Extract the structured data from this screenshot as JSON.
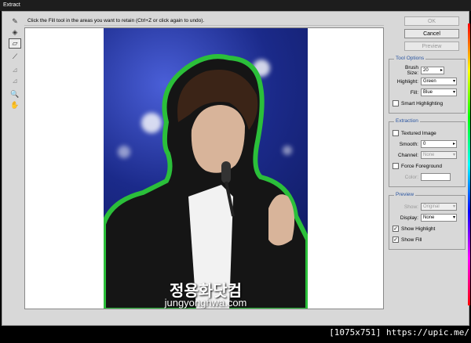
{
  "window": {
    "title": "Extract"
  },
  "instruction": "Click the Fill tool in the areas you want to retain (Ctrl+Z or click again to undo).",
  "tools": [
    {
      "name": "edge-highlighter-icon",
      "glyph": "✎"
    },
    {
      "name": "fill-bucket-icon",
      "glyph": "◈"
    },
    {
      "name": "eraser-icon",
      "glyph": "▱"
    },
    {
      "name": "eyedropper-icon",
      "glyph": "⟋"
    },
    {
      "name": "cleanup-tool-icon",
      "glyph": "⊿"
    },
    {
      "name": "edge-touchup-icon",
      "glyph": "⊿"
    },
    {
      "name": "zoom-icon",
      "glyph": "🔍"
    },
    {
      "name": "hand-icon",
      "glyph": "✋"
    }
  ],
  "buttons": {
    "ok": "OK",
    "cancel": "Cancel",
    "preview": "Preview"
  },
  "tool_options": {
    "title": "Tool Options",
    "brush_size_label": "Brush Size:",
    "brush_size_value": "20",
    "highlight_label": "Highlight:",
    "highlight_value": "Green",
    "fill_label": "Fill:",
    "fill_value": "Blue",
    "smart_highlighting": "Smart Highlighting"
  },
  "extraction": {
    "title": "Extraction",
    "textured_image": "Textured Image",
    "smooth_label": "Smooth:",
    "smooth_value": "0",
    "channel_label": "Channel:",
    "channel_value": "None",
    "force_foreground": "Force Foreground",
    "color_label": "Color:"
  },
  "preview": {
    "title": "Preview",
    "show_label": "Show:",
    "show_value": "Original",
    "display_label": "Display:",
    "display_value": "None",
    "show_highlight": "Show Highlight",
    "show_fill": "Show Fill",
    "check_mark": "✓"
  },
  "photo": {
    "watermark": "정용화닷컴",
    "watermark_sub": "jungyonghwa.com"
  },
  "credit": "[1075x751] https://upic.me/",
  "colors": {
    "highlight": "#2bbf3a",
    "accent": "#2a55a0"
  }
}
